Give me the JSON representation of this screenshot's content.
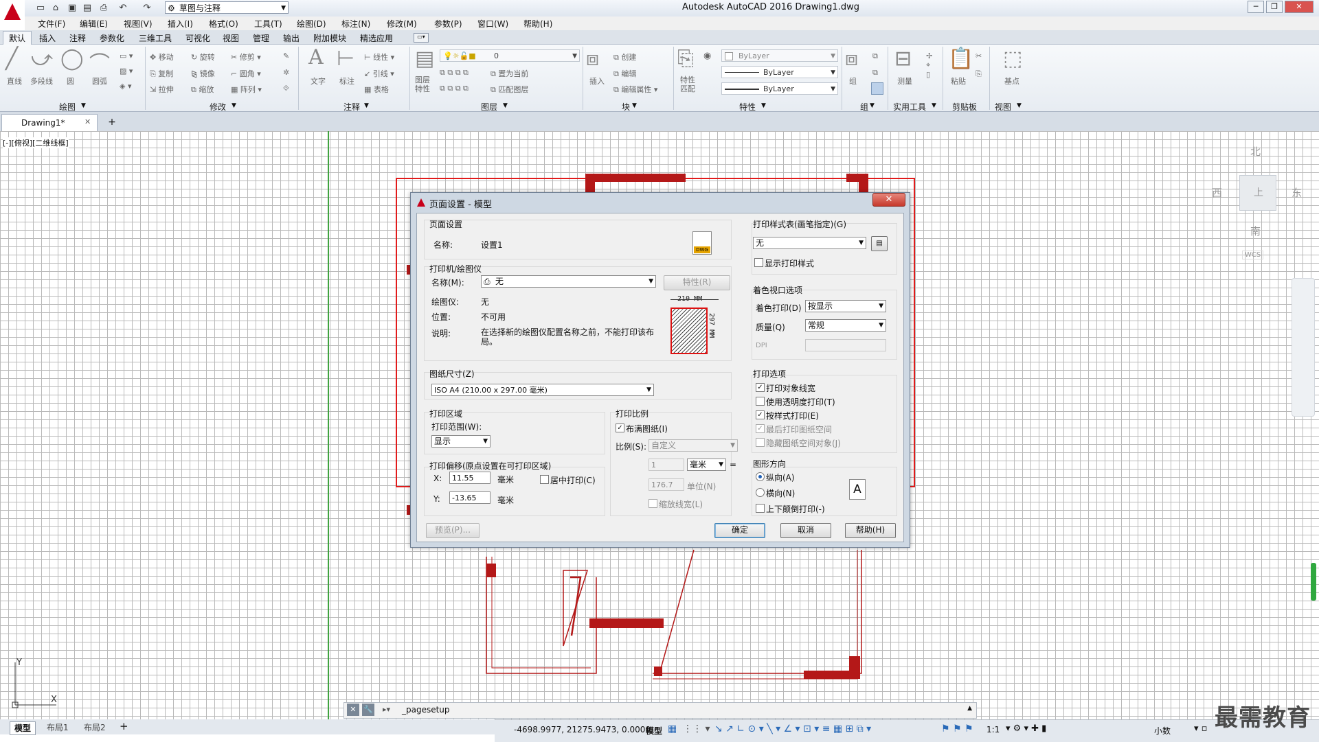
{
  "window": {
    "title": "Autodesk AutoCAD 2016    Drawing1.dwg",
    "workspace": "草图与注释"
  },
  "menu": [
    "文件(F)",
    "编辑(E)",
    "视图(V)",
    "插入(I)",
    "格式(O)",
    "工具(T)",
    "绘图(D)",
    "标注(N)",
    "修改(M)",
    "参数(P)",
    "窗口(W)",
    "帮助(H)"
  ],
  "ribbon_tabs": [
    "默认",
    "插入",
    "注释",
    "参数化",
    "三维工具",
    "可视化",
    "视图",
    "管理",
    "输出",
    "附加模块",
    "精选应用"
  ],
  "ribbon": {
    "panels": [
      "绘图",
      "修改",
      "注释",
      "图层",
      "块",
      "特性",
      "组",
      "实用工具",
      "剪贴板",
      "视图"
    ],
    "draw_tools": [
      "直线",
      "多段线",
      "圆",
      "圆弧"
    ],
    "modify_tools": [
      "移动",
      "旋转",
      "修剪",
      "复制",
      "镜像",
      "圆角",
      "拉伸",
      "缩放",
      "阵列"
    ],
    "annotate_tools": [
      "文字",
      "标注",
      "线性",
      "引线",
      "表格"
    ],
    "layer_tools": [
      "图层特性",
      "置为当前",
      "匹配图层"
    ],
    "layer_value": "0",
    "block_tools": [
      "插入",
      "创建",
      "编辑",
      "编辑属性"
    ],
    "properties": {
      "match": "特性匹配",
      "color": "ByLayer",
      "linetype": "ByLayer",
      "lineweight": "ByLayer"
    },
    "group": "组",
    "utilities": "测量",
    "clipboard": "粘贴",
    "view_base": "基点"
  },
  "doc_tab": {
    "label": "Drawing1*"
  },
  "viewport_label": "[-][俯视][二维线框]",
  "viewcube": {
    "north": "北",
    "south": "南",
    "east": "东",
    "west": "西",
    "top": "上",
    "wcs": "WCS"
  },
  "dialog": {
    "title": "页面设置 - 模型",
    "page_setup": {
      "group": "页面设置",
      "name_label": "名称:",
      "name_value": "设置1"
    },
    "printer": {
      "group": "打印机/绘图仪",
      "name_label": "名称(M):",
      "name_value": "无",
      "properties_button": "特性(R)",
      "plotter_label": "绘图仪:",
      "plotter_value": "无",
      "location_label": "位置:",
      "location_value": "不可用",
      "desc_label": "说明:",
      "desc_value": "在选择新的绘图仪配置名称之前，不能打印该布局。",
      "preview_width": "210 MM",
      "preview_height": "297 MM"
    },
    "paper_size": {
      "group": "图纸尺寸(Z)",
      "value": "ISO A4 (210.00 x 297.00 毫米)"
    },
    "plot_area": {
      "group": "打印区域",
      "range_label": "打印范围(W):",
      "range_value": "显示"
    },
    "plot_offset": {
      "group": "打印偏移(原点设置在可打印区域)",
      "x_label": "X:",
      "x_value": "11.55",
      "x_unit": "毫米",
      "y_label": "Y:",
      "y_value": "-13.65",
      "y_unit": "毫米",
      "center_label": "居中打印(C)"
    },
    "plot_scale": {
      "group": "打印比例",
      "fit_label": "布满图纸(I)",
      "scale_label": "比例(S):",
      "scale_value": "自定义",
      "val1": "1",
      "unit1": "毫米",
      "eq": "=",
      "val2": "176.7",
      "unit2": "单位(N)",
      "lineweight_label": "缩放线宽(L)"
    },
    "style_table": {
      "group": "打印样式表(画笔指定)(G)",
      "value": "无",
      "show_label": "显示打印样式"
    },
    "shaded": {
      "group": "着色视口选项",
      "shade_label": "着色打印(D)",
      "shade_value": "按显示",
      "quality_label": "质量(Q)",
      "quality_value": "常规",
      "dpi_label": "DPI"
    },
    "options": {
      "group": "打印选项",
      "items": [
        "打印对象线宽",
        "使用透明度打印(T)",
        "按样式打印(E)",
        "最后打印图纸空间",
        "隐藏图纸空间对象(J)"
      ]
    },
    "orientation": {
      "group": "图形方向",
      "portrait": "纵向(A)",
      "landscape": "横向(N)",
      "upside": "上下颠倒打印(-)",
      "icon_letter": "A"
    },
    "buttons": {
      "preview": "预览(P)...",
      "ok": "确定",
      "cancel": "取消",
      "help": "帮助(H)"
    }
  },
  "command_line": {
    "text": "_pagesetup"
  },
  "layout_tabs": [
    "模型",
    "布局1",
    "布局2"
  ],
  "status": {
    "coords": "-4698.9977, 21275.9473, 0.0000",
    "model": "模型",
    "scale": "1:1",
    "units": "小数"
  },
  "watermark": "最需教育"
}
